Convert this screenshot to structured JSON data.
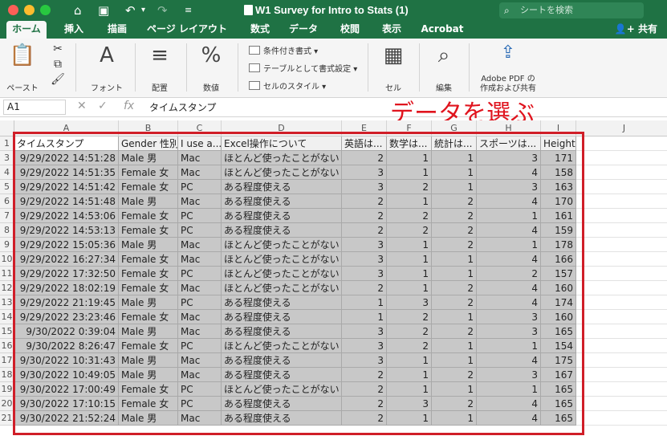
{
  "titlebar": {
    "doc_title": "W1 Survey for Intro to Stats (1)",
    "search_placeholder": "シートを検索"
  },
  "tabs": [
    "ホーム",
    "挿入",
    "描画",
    "ページ レイアウト",
    "数式",
    "データ",
    "校閲",
    "表示",
    "Acrobat"
  ],
  "share_label": "共有",
  "ribbon": {
    "paste": "ペースト",
    "font": "フォント",
    "align": "配置",
    "number": "数値",
    "cond_format": "条件付き書式",
    "table_format": "テーブルとして書式設定",
    "cell_style": "セルのスタイル",
    "cells": "セル",
    "edit": "編集",
    "pdf_line1": "Adobe PDF の",
    "pdf_line2": "作成および共有"
  },
  "formula_bar": {
    "cell_ref": "A1",
    "content": "タイムスタンプ"
  },
  "annotation": "データを選ぶ",
  "columns": [
    "A",
    "B",
    "C",
    "D",
    "E",
    "F",
    "G",
    "H",
    "I",
    "J"
  ],
  "row_numbers": [
    "1",
    "3",
    "4",
    "5",
    "6",
    "7",
    "8",
    "9",
    "10",
    "11",
    "12",
    "13",
    "14",
    "15",
    "16",
    "17",
    "18",
    "19",
    "20",
    "21"
  ],
  "headers": [
    "タイムスタンプ",
    "Gender 性別",
    "I use a...",
    "Excel操作について",
    "英語は...",
    "数学は...",
    "統計は...",
    "スポーツは...",
    "Height"
  ],
  "rows": [
    [
      "9/29/2022 14:51:28",
      "Male 男",
      "Mac",
      "ほとんど使ったことがない",
      "2",
      "1",
      "1",
      "3",
      "171"
    ],
    [
      "9/29/2022 14:51:35",
      "Female 女",
      "Mac",
      "ほとんど使ったことがない",
      "3",
      "1",
      "1",
      "4",
      "158"
    ],
    [
      "9/29/2022 14:51:42",
      "Female 女",
      "PC",
      "ある程度使える",
      "3",
      "2",
      "1",
      "3",
      "163"
    ],
    [
      "9/29/2022 14:51:48",
      "Male 男",
      "Mac",
      "ある程度使える",
      "2",
      "1",
      "2",
      "4",
      "170"
    ],
    [
      "9/29/2022 14:53:06",
      "Female 女",
      "PC",
      "ある程度使える",
      "2",
      "2",
      "2",
      "1",
      "161"
    ],
    [
      "9/29/2022 14:53:13",
      "Female 女",
      "PC",
      "ある程度使える",
      "2",
      "2",
      "2",
      "4",
      "159"
    ],
    [
      "9/29/2022 15:05:36",
      "Male 男",
      "Mac",
      "ほとんど使ったことがない",
      "3",
      "1",
      "2",
      "1",
      "178"
    ],
    [
      "9/29/2022 16:27:34",
      "Female 女",
      "Mac",
      "ほとんど使ったことがない",
      "3",
      "1",
      "1",
      "4",
      "166"
    ],
    [
      "9/29/2022 17:32:50",
      "Female 女",
      "PC",
      "ほとんど使ったことがない",
      "3",
      "1",
      "1",
      "2",
      "157"
    ],
    [
      "9/29/2022 18:02:19",
      "Female 女",
      "Mac",
      "ほとんど使ったことがない",
      "2",
      "1",
      "2",
      "4",
      "160"
    ],
    [
      "9/29/2022 21:19:45",
      "Male 男",
      "PC",
      "ある程度使える",
      "1",
      "3",
      "2",
      "4",
      "174"
    ],
    [
      "9/29/2022 23:23:46",
      "Female 女",
      "Mac",
      "ある程度使える",
      "1",
      "2",
      "1",
      "3",
      "160"
    ],
    [
      "9/30/2022 0:39:04",
      "Male 男",
      "Mac",
      "ある程度使える",
      "3",
      "2",
      "2",
      "3",
      "165"
    ],
    [
      "9/30/2022 8:26:47",
      "Female 女",
      "PC",
      "ほとんど使ったことがない",
      "3",
      "2",
      "1",
      "1",
      "154"
    ],
    [
      "9/30/2022 10:31:43",
      "Male 男",
      "Mac",
      "ある程度使える",
      "3",
      "1",
      "1",
      "4",
      "175"
    ],
    [
      "9/30/2022 10:49:05",
      "Male 男",
      "Mac",
      "ある程度使える",
      "2",
      "1",
      "2",
      "3",
      "167"
    ],
    [
      "9/30/2022 17:00:49",
      "Female 女",
      "PC",
      "ほとんど使ったことがない",
      "2",
      "1",
      "1",
      "1",
      "165"
    ],
    [
      "9/30/2022 17:10:15",
      "Female 女",
      "PC",
      "ある程度使える",
      "2",
      "3",
      "2",
      "4",
      "165"
    ],
    [
      "9/30/2022 21:52:24",
      "Male 男",
      "Mac",
      "ある程度使える",
      "2",
      "1",
      "1",
      "4",
      "165"
    ]
  ]
}
